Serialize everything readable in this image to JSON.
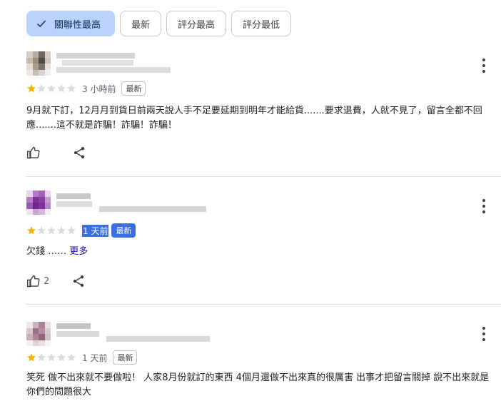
{
  "filters": {
    "items": [
      {
        "label": "關聯性最高",
        "selected": true
      },
      {
        "label": "最新",
        "selected": false
      },
      {
        "label": "評分最高",
        "selected": false
      },
      {
        "label": "評分最低",
        "selected": false
      }
    ]
  },
  "reviews": [
    {
      "rating": 1,
      "time": "3 小時前",
      "badge": "最新",
      "text": "9月就下訂，12月月到貨日前兩天說人手不足要延期到明年才能給貨.......要求退費，人就不見了，留言全都不回應.......這不就是詐騙！詐騙！詐騙！",
      "likes": ""
    },
    {
      "rating": 1,
      "time": "1 天前",
      "badge": "最新",
      "text": "欠錢 ……",
      "more": "更多",
      "likes": "2"
    },
    {
      "rating": 1,
      "time": "1 天前",
      "badge": "最新",
      "text": "笑死 做不出來就不要做啦！ 人家8月份就訂的東西 4個月還做不出來真的很厲害 出事才把留言關掉 說不出來就是你們的問題很大"
    }
  ],
  "colors": {
    "star_filled": "#f4b400",
    "star_empty": "#dadce0",
    "chip_selected": "#b9d3fb"
  }
}
